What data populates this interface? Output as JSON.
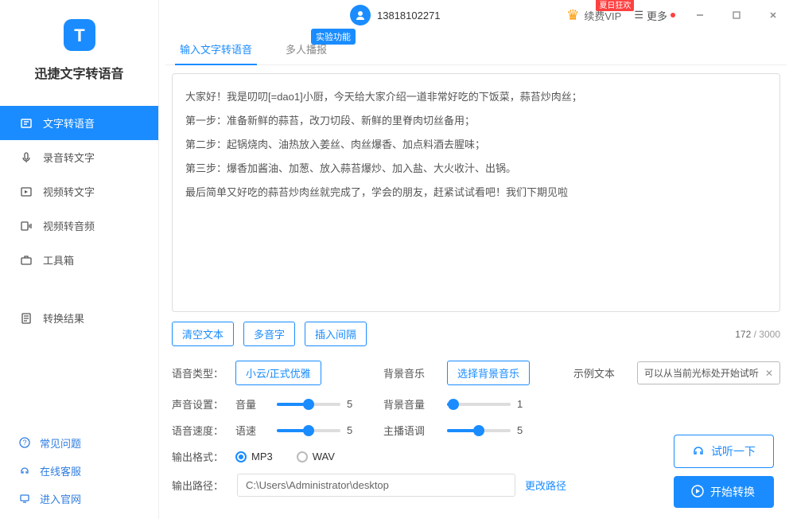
{
  "app": {
    "title": "迅捷文字转语音"
  },
  "titlebar": {
    "phone": "13818102271",
    "vip_label": "续费VIP",
    "vip_promo": "夏日狂欢",
    "more_label": "更多"
  },
  "sidebar": {
    "items": [
      {
        "label": "文字转语音",
        "active": true
      },
      {
        "label": "录音转文字"
      },
      {
        "label": "视频转文字"
      },
      {
        "label": "视频转音频"
      },
      {
        "label": "工具箱"
      }
    ],
    "result_label": "转换结果",
    "bottom": {
      "faq": "常见问题",
      "support": "在线客服",
      "site": "进入官网"
    }
  },
  "tabs": {
    "t1": "输入文字转语音",
    "t2": "多人播报",
    "badge": "实验功能"
  },
  "text": {
    "lines": [
      "大家好！我是叨叨[=dao1]小厨，今天给大家介绍一道非常好吃的下饭菜，蒜苔炒肉丝；",
      "第一步：准备新鲜的蒜苔，改刀切段、新鲜的里脊肉切丝备用；",
      "第二步：起锅烧肉、油热放入姜丝、肉丝爆香、加点料酒去腥味；",
      "第三步：爆香加酱油、加葱、放入蒜苔爆炒、加入盐、大火收汁、出锅。",
      "最后简单又好吃的蒜苔炒肉丝就完成了，学会的朋友，赶紧试试看吧！我们下期见啦"
    ],
    "count_current": "172",
    "count_max": "3000"
  },
  "buttons": {
    "clear": "清空文本",
    "polyphone": "多音字",
    "insert_pause": "插入间隔",
    "preview": "试听一下",
    "convert": "开始转换"
  },
  "settings": {
    "voice_type_label": "语音类型：",
    "voice_type_value": "小云/正式优雅",
    "bg_music_label": "背景音乐",
    "bg_music_value": "选择背景音乐",
    "example_label": "示例文本",
    "example_value": "可以从当前光标处开始试听",
    "volume_section": "声音设置：",
    "volume_label": "音量",
    "volume_value": "5",
    "bg_volume_label": "背景音量",
    "bg_volume_value": "1",
    "speed_section": "语音速度：",
    "speed_label": "语速",
    "speed_value": "5",
    "pitch_label": "主播语调",
    "pitch_value": "5",
    "format_label": "输出格式：",
    "format_mp3": "MP3",
    "format_wav": "WAV",
    "path_label": "输出路径：",
    "path_value": "C:\\Users\\Administrator\\desktop",
    "path_change": "更改路径"
  }
}
